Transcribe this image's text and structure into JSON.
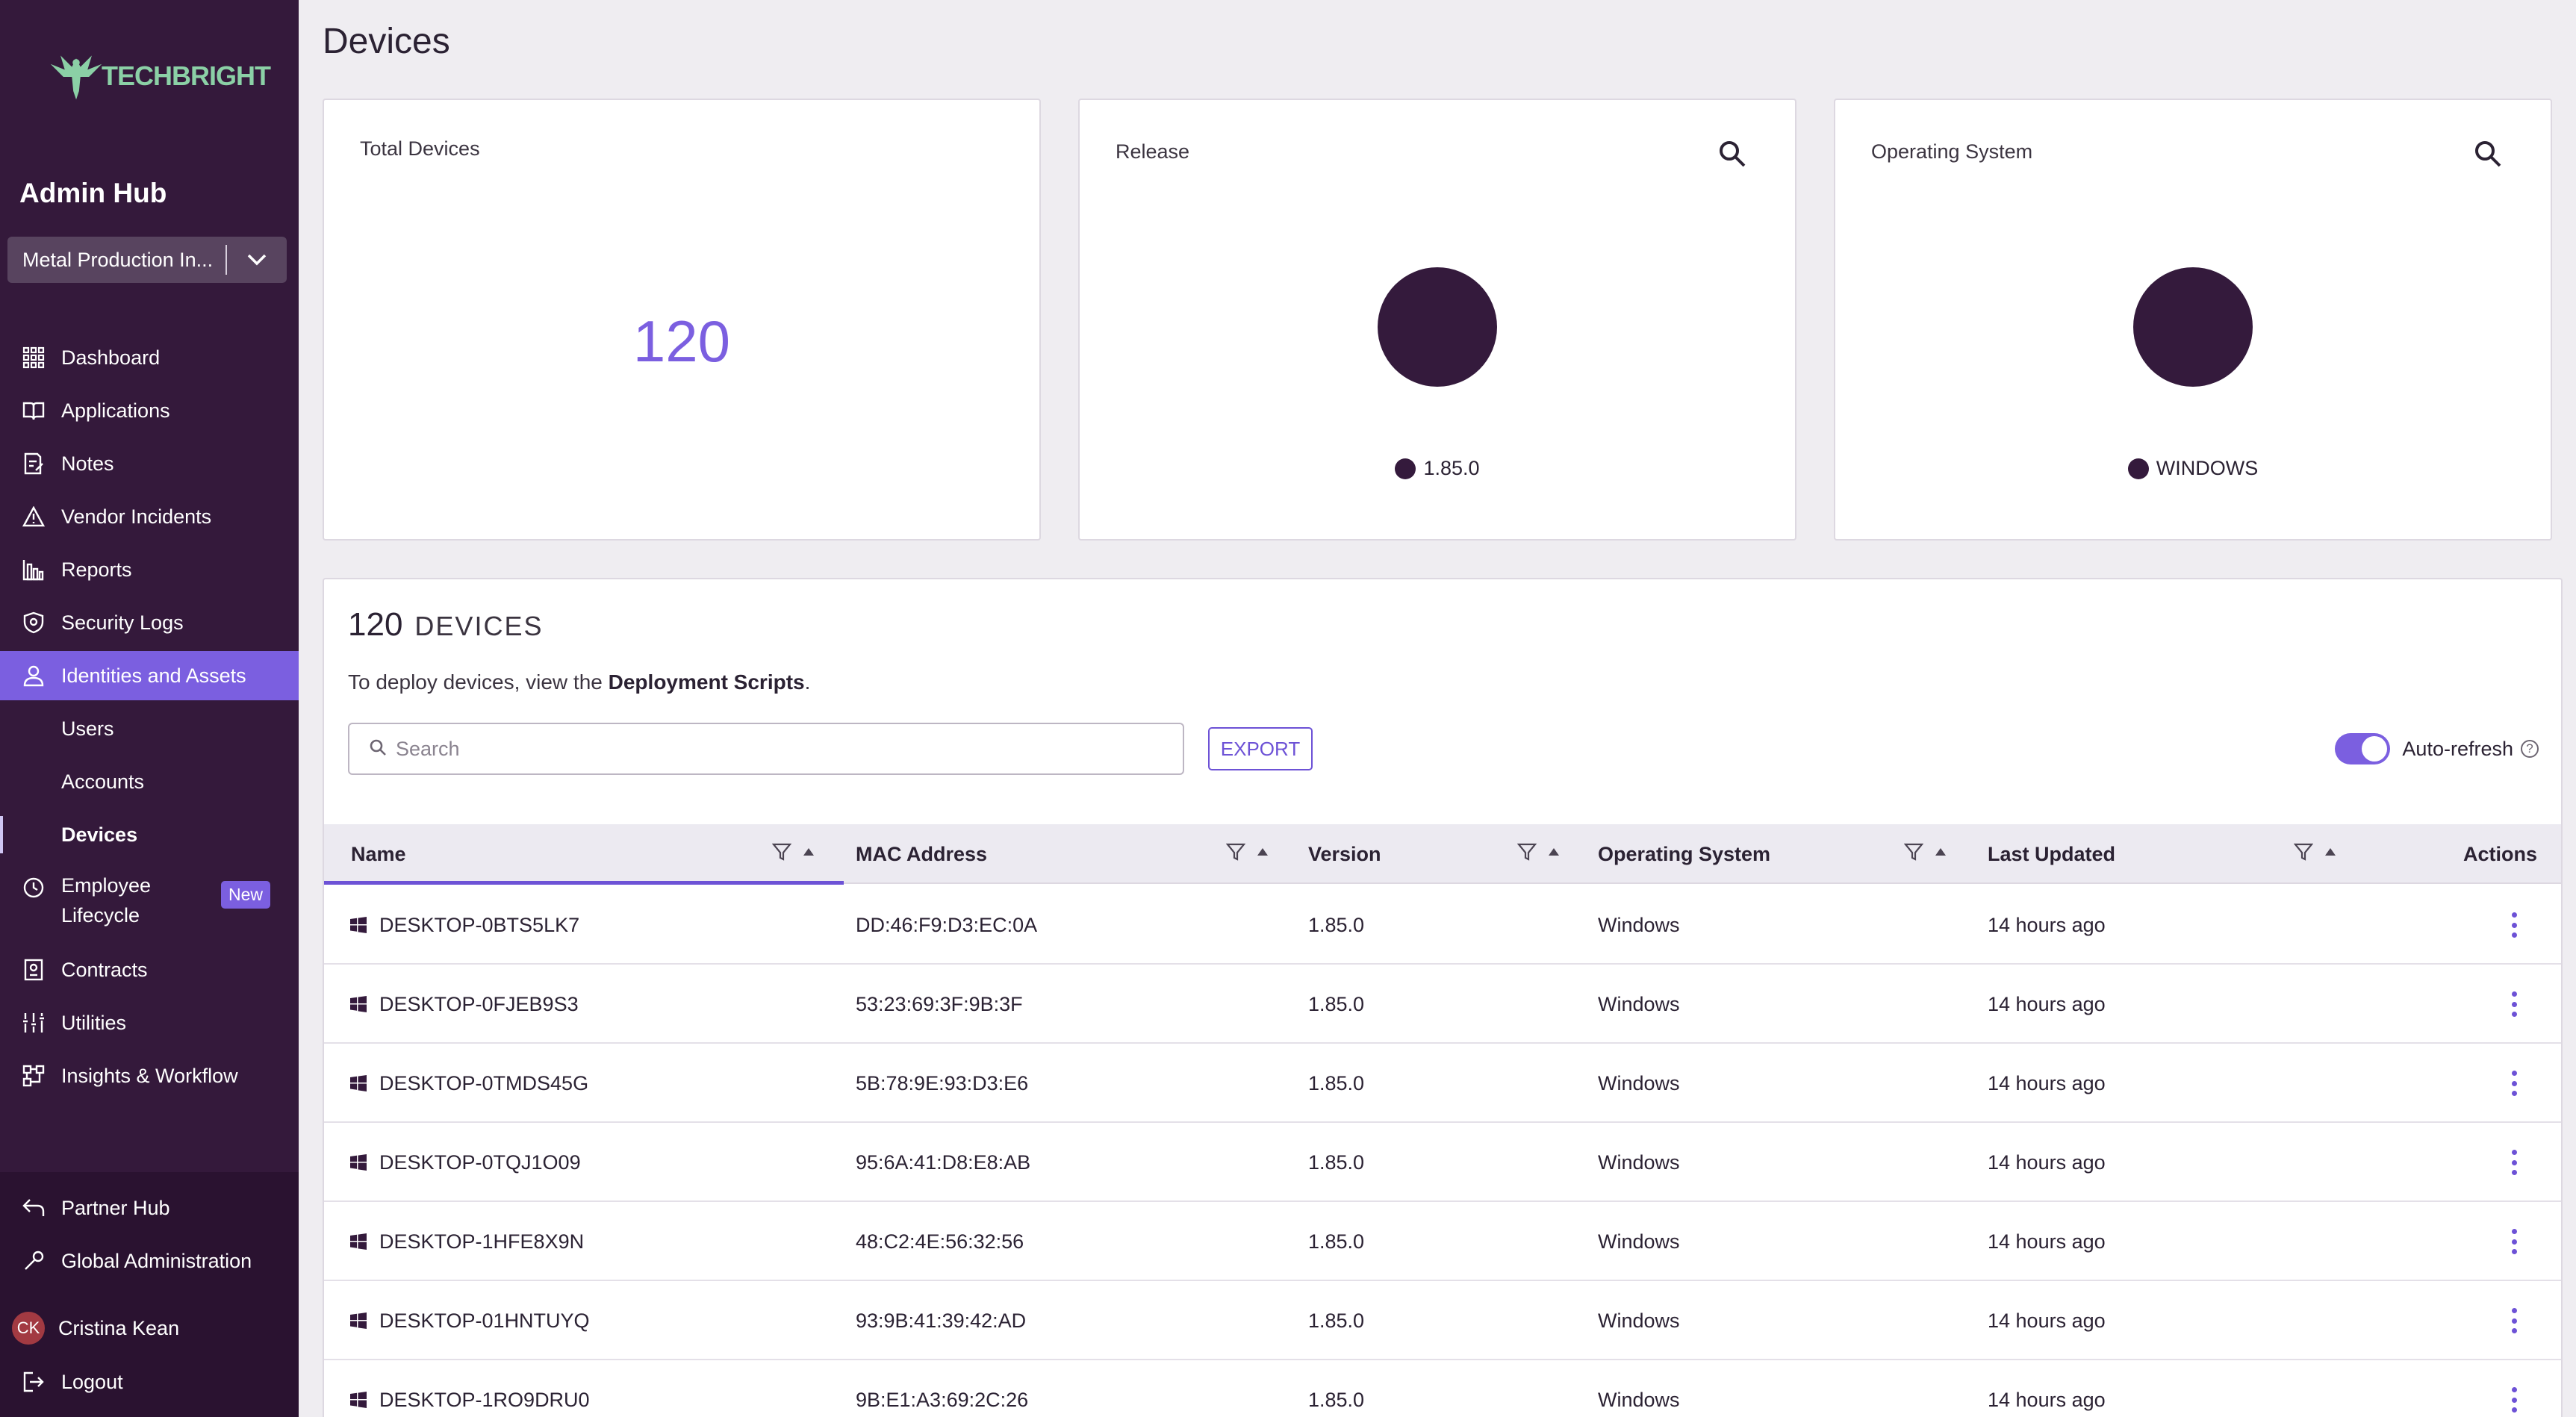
{
  "app": {
    "logo_text": "TECHBRIGHT",
    "hub_title": "Admin Hub",
    "org_select": "Metal Production In..."
  },
  "sidebar": {
    "items": [
      {
        "label": "Dashboard",
        "icon": "grid-icon"
      },
      {
        "label": "Applications",
        "icon": "book-icon"
      },
      {
        "label": "Notes",
        "icon": "note-icon"
      },
      {
        "label": "Vendor Incidents",
        "icon": "warning-icon"
      },
      {
        "label": "Reports",
        "icon": "bar-chart-icon"
      },
      {
        "label": "Security Logs",
        "icon": "shield-icon"
      },
      {
        "label": "Identities and Assets",
        "icon": "user-icon"
      }
    ],
    "subitems": [
      {
        "label": "Users"
      },
      {
        "label": "Accounts"
      },
      {
        "label": "Devices"
      }
    ],
    "lower_items": [
      {
        "label_line1": "Employee",
        "label_line2": "Lifecycle",
        "icon": "history-icon",
        "badge": "New"
      },
      {
        "label": "Contracts",
        "icon": "contract-icon"
      },
      {
        "label": "Utilities",
        "icon": "tools-icon"
      },
      {
        "label": "Insights & Workflow",
        "icon": "workflow-icon"
      }
    ],
    "bottom": {
      "partner_hub": "Partner Hub",
      "global_admin": "Global Administration",
      "user_initials": "CK",
      "user_name": "Cristina Kean",
      "logout": "Logout"
    }
  },
  "page": {
    "title": "Devices"
  },
  "cards": {
    "total": {
      "title": "Total Devices",
      "value": "120"
    },
    "release": {
      "title": "Release",
      "legend": "1.85.0"
    },
    "os": {
      "title": "Operating System",
      "legend": "WINDOWS"
    }
  },
  "panel": {
    "count": "120",
    "count_label": "DEVICES",
    "deploy_prefix": "To deploy devices, view the ",
    "deploy_link": "Deployment Scripts",
    "deploy_suffix": ".",
    "search_placeholder": "Search",
    "export_label": "EXPORT",
    "auto_refresh_label": "Auto-refresh",
    "auto_refresh_on": true
  },
  "table": {
    "columns": {
      "name": "Name",
      "mac": "MAC Address",
      "version": "Version",
      "os": "Operating System",
      "updated": "Last Updated",
      "actions": "Actions"
    },
    "rows": [
      {
        "name": "DESKTOP-0BTS5LK7",
        "mac": "DD:46:F9:D3:EC:0A",
        "version": "1.85.0",
        "os": "Windows",
        "updated": "14 hours ago"
      },
      {
        "name": "DESKTOP-0FJEB9S3",
        "mac": "53:23:69:3F:9B:3F",
        "version": "1.85.0",
        "os": "Windows",
        "updated": "14 hours ago"
      },
      {
        "name": "DESKTOP-0TMDS45G",
        "mac": "5B:78:9E:93:D3:E6",
        "version": "1.85.0",
        "os": "Windows",
        "updated": "14 hours ago"
      },
      {
        "name": "DESKTOP-0TQJ1O09",
        "mac": "95:6A:41:D8:E8:AB",
        "version": "1.85.0",
        "os": "Windows",
        "updated": "14 hours ago"
      },
      {
        "name": "DESKTOP-1HFE8X9N",
        "mac": "48:C2:4E:56:32:56",
        "version": "1.85.0",
        "os": "Windows",
        "updated": "14 hours ago"
      },
      {
        "name": "DESKTOP-01HNTUYQ",
        "mac": "93:9B:41:39:42:AD",
        "version": "1.85.0",
        "os": "Windows",
        "updated": "14 hours ago"
      },
      {
        "name": "DESKTOP-1RO9DRU0",
        "mac": "9B:E1:A3:69:2C:26",
        "version": "1.85.0",
        "os": "Windows",
        "updated": "14 hours ago"
      }
    ]
  },
  "colors": {
    "sidebar_bg": "#34193b",
    "accent": "#7b5fe0",
    "chart_fill": "#341a3c",
    "logo_green": "#8bd0a6"
  }
}
